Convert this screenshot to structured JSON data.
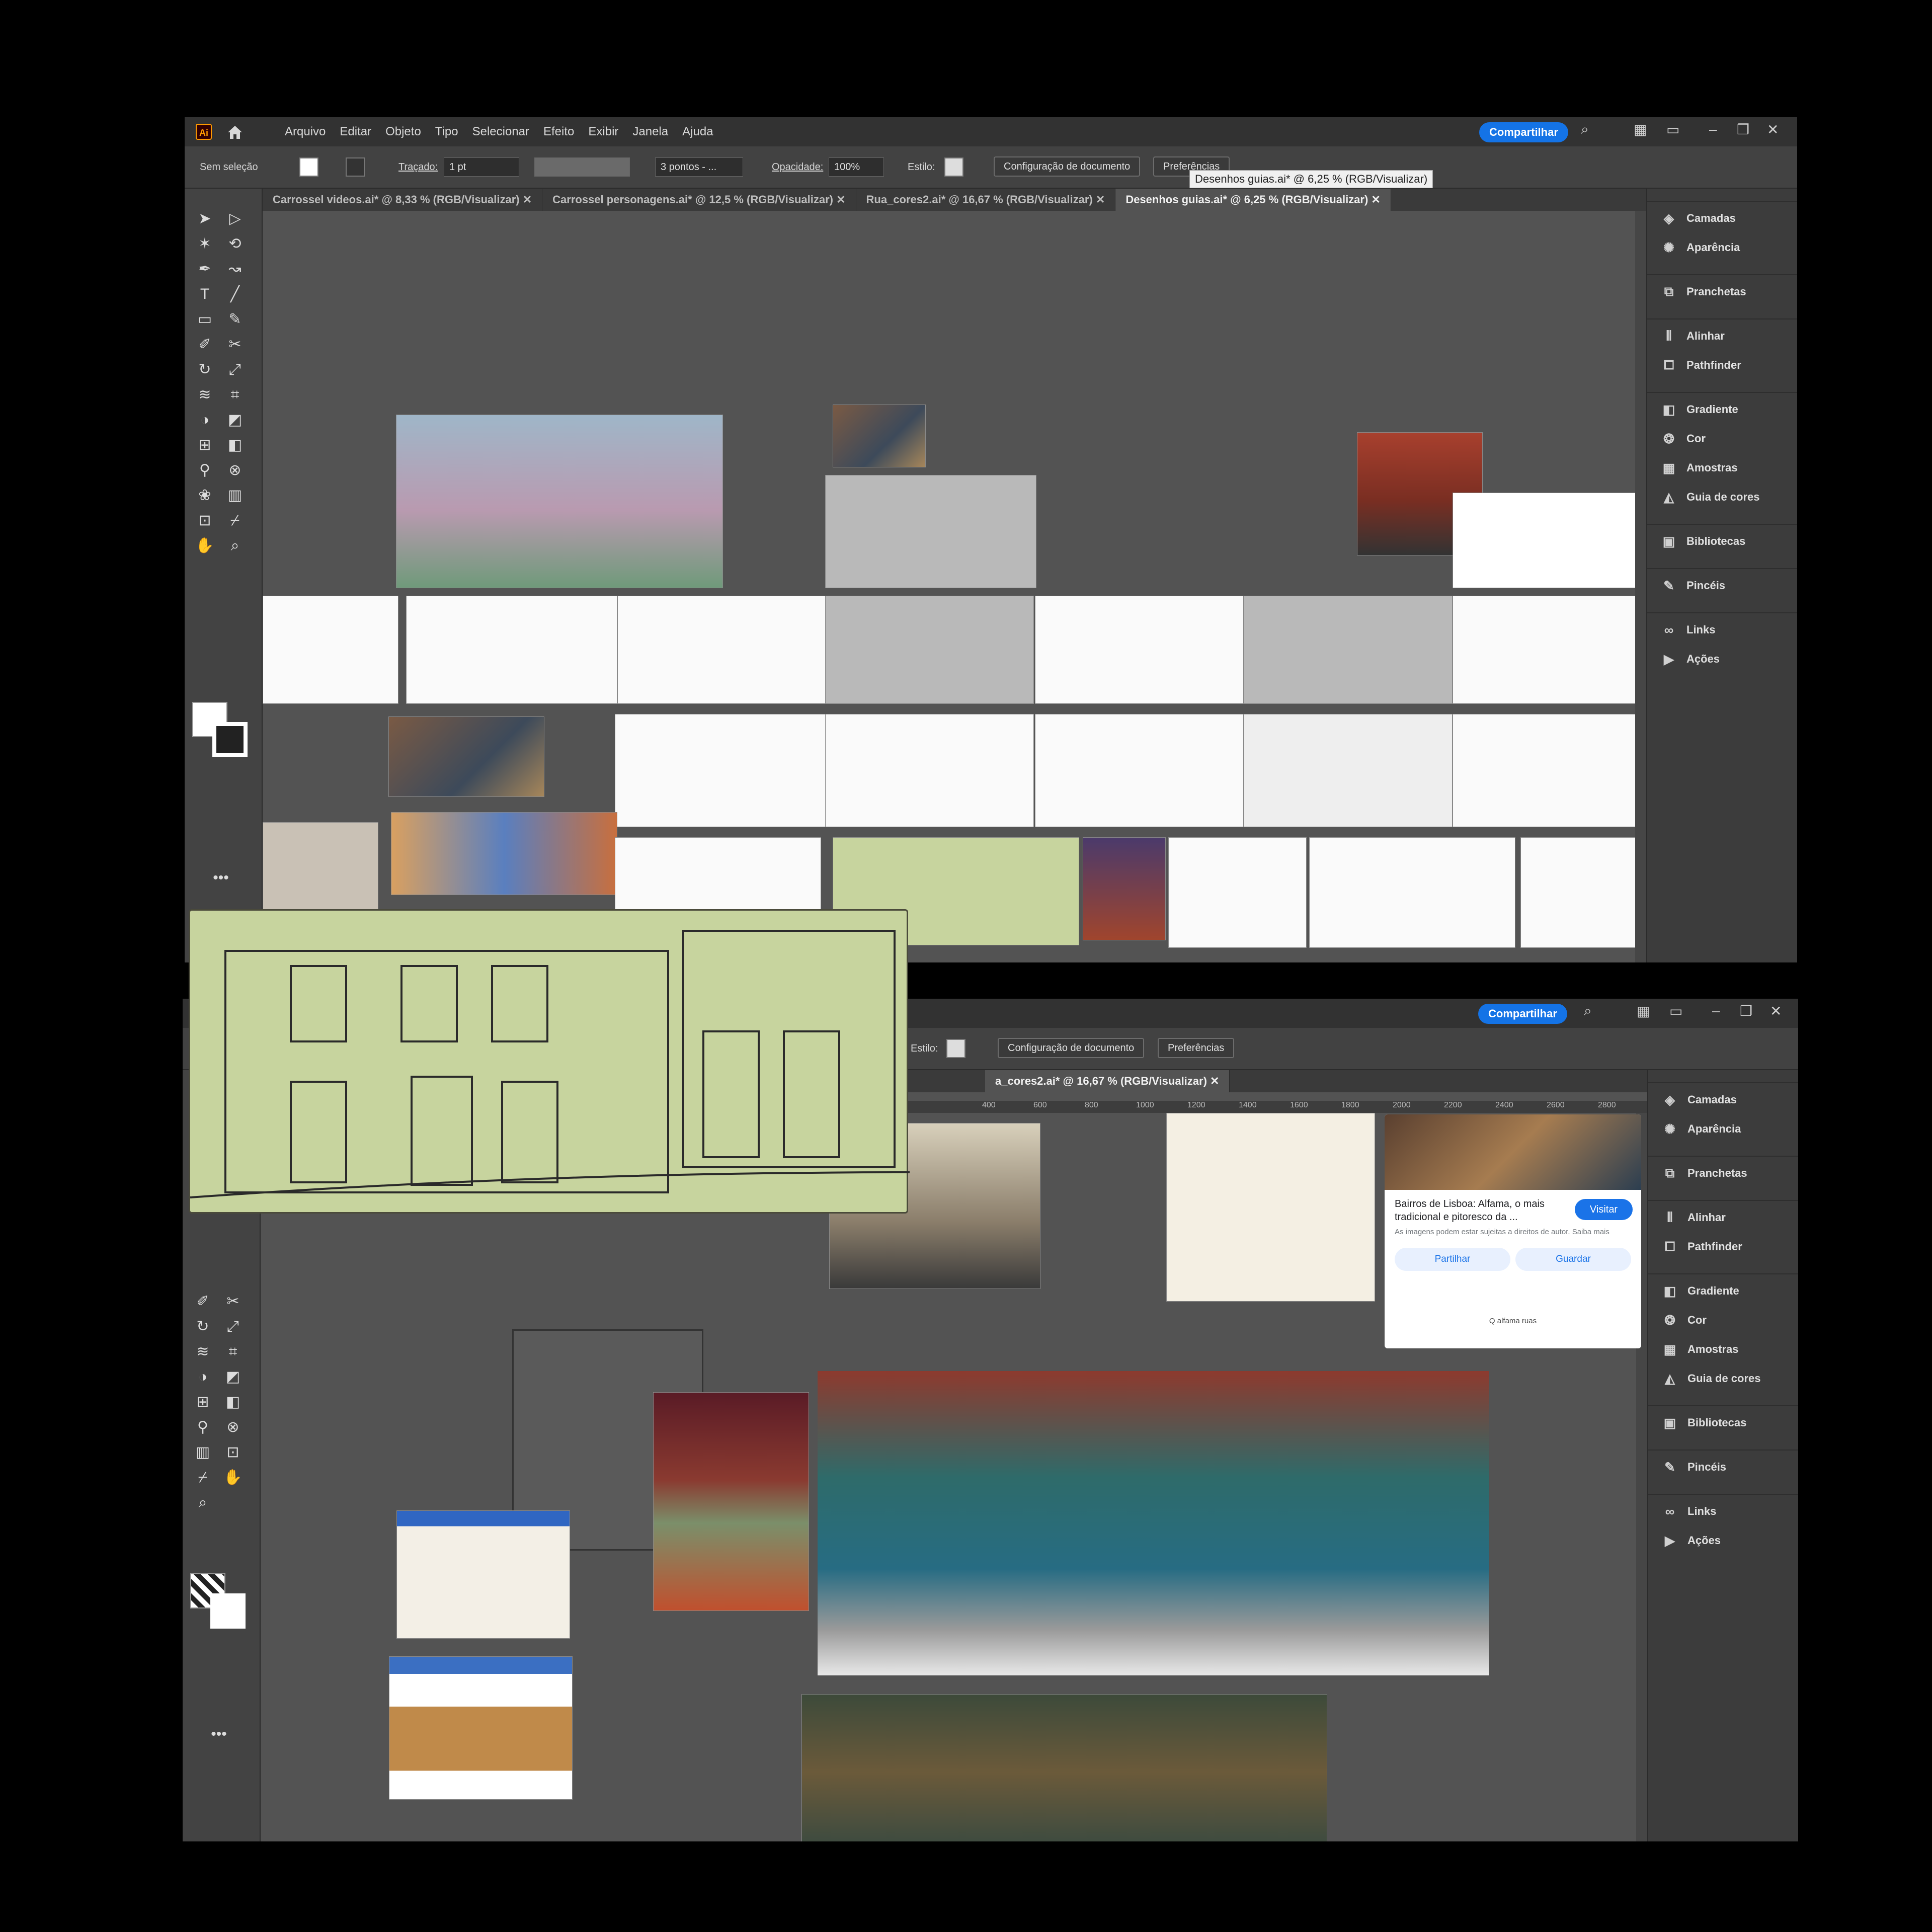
{
  "app": {
    "logo": "Ai",
    "menu": [
      "Arquivo",
      "Editar",
      "Objeto",
      "Tipo",
      "Selecionar",
      "Efeito",
      "Exibir",
      "Janela",
      "Ajuda"
    ],
    "share_label": "Compartilhar"
  },
  "control_bar": {
    "selection": "Sem seleção",
    "stroke_label": "Traçado:",
    "stroke_value": "1 pt",
    "brush_value": "3 pontos - ...",
    "opacity_label": "Opacidade:",
    "opacity_value": "100%",
    "style_label": "Estilo:",
    "doc_setup": "Configuração de documento",
    "preferences": "Preferências"
  },
  "tooltip": "Desenhos guias.ai* @ 6,25 % (RGB/Visualizar)",
  "tabs": [
    "Carrossel videos.ai* @ 8,33 % (RGB/Visualizar)",
    "Carrossel personagens.ai* @ 12,5 % (RGB/Visualizar)",
    "Rua_cores2.ai* @ 16,67 % (RGB/Visualizar)",
    "Desenhos guias.ai* @ 6,25 % (RGB/Visualizar)"
  ],
  "tab2_partial": "a_cores2.ai* @ 16,67 % (RGB/Visualizar)",
  "ruler_ticks": [
    "400",
    "600",
    "800",
    "1000",
    "1200",
    "1400",
    "1600",
    "1800",
    "2000",
    "2200",
    "2400",
    "2600",
    "2800"
  ],
  "panels": [
    {
      "label": "Camadas",
      "icon": "layers-icon"
    },
    {
      "label": "Aparência",
      "icon": "appearance-icon"
    },
    {
      "label": "Pranchetas",
      "icon": "artboards-icon"
    },
    {
      "label": "Alinhar",
      "icon": "align-icon"
    },
    {
      "label": "Pathfinder",
      "icon": "pathfinder-icon"
    },
    {
      "label": "Gradiente",
      "icon": "gradient-icon"
    },
    {
      "label": "Cor",
      "icon": "color-icon"
    },
    {
      "label": "Amostras",
      "icon": "swatches-icon"
    },
    {
      "label": "Guia de cores",
      "icon": "color-guide-icon"
    },
    {
      "label": "Bibliotecas",
      "icon": "libraries-icon"
    },
    {
      "label": "Pincéis",
      "icon": "brushes-icon"
    },
    {
      "label": "Links",
      "icon": "links-icon"
    },
    {
      "label": "Ações",
      "icon": "actions-icon"
    }
  ],
  "search_card": {
    "title": "Bairros de Lisboa: Alfama, o mais tradicional e pitoresco da ...",
    "visit": "Visitar",
    "note": "As imagens podem estar sujeitas a direitos de autor. Saiba mais",
    "share": "Partilhar",
    "save": "Guardar",
    "query": "Q alfama ruas"
  },
  "colors": {
    "accent": "#1473e6",
    "ui_dark": "#323232",
    "ui_mid": "#535353",
    "sketch_green": "#c7d49e"
  }
}
